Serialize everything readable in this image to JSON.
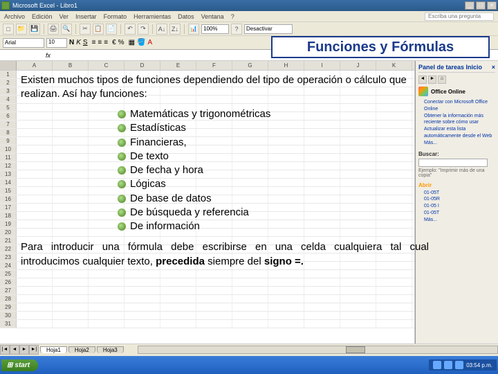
{
  "window": {
    "title": "Microsoft Excel - Libro1"
  },
  "menus": [
    "Archivo",
    "Edición",
    "Ver",
    "Insertar",
    "Formato",
    "Herramientas",
    "Datos",
    "Ventana",
    "?"
  ],
  "help_placeholder": "Escriba una pregunta",
  "toolbar": {
    "zoom": "100%",
    "dropdown": "Desactivar"
  },
  "format": {
    "font_name": "Arial",
    "font_size": "10"
  },
  "ref": {
    "cell_ref": "",
    "fx": "fx"
  },
  "columns": [
    "A",
    "B",
    "C",
    "D",
    "E",
    "F",
    "G",
    "H",
    "I",
    "J",
    "K"
  ],
  "rows": [
    "1",
    "2",
    "3",
    "4",
    "5",
    "6",
    "7",
    "8",
    "9",
    "10",
    "11",
    "12",
    "13",
    "14",
    "15",
    "16",
    "17",
    "18",
    "19",
    "20",
    "21",
    "22",
    "23",
    "24",
    "25",
    "26",
    "27",
    "28",
    "29",
    "30",
    "31"
  ],
  "overlay": {
    "title": "Funciones y Fórmulas",
    "intro": "Existen muchos tipos de funciones dependiendo del tipo de operación o cálculo que realizan. Así hay funciones:",
    "bullets": [
      "Matemáticas y trigonométricas",
      "Estadísticas",
      "Financieras,",
      "De texto",
      "De fecha y hora",
      "Lógicas",
      "De base de datos",
      "De búsqueda y referencia",
      "De información"
    ],
    "outro_pre": "Para introducir una fórmula debe escribirse en una celda cualquiera tal cual introducimos cualquier texto, ",
    "outro_bold": "precedida",
    "outro_mid": " siempre del ",
    "outro_bold2": "signo =."
  },
  "taskpane": {
    "title": "Panel de tareas Inicio",
    "office_label": "Office Online",
    "links": [
      "Conectar con Microsoft Office Online",
      "Obtener la información más reciente sobre cómo usar",
      "Actualizar esta lista automáticamente desde el Web",
      "Más..."
    ],
    "search_label": "Buscar:",
    "example": "Ejemplo: \"Imprimir más de una copia\"",
    "abrir": "Abrir",
    "files": [
      "01-05T",
      "01-05R",
      "01-05 I",
      "01-05T",
      "Más..."
    ]
  },
  "sheet_tabs": [
    "Hoja1",
    "Hoja2",
    "Hoja3"
  ],
  "taskbar": {
    "start": "start",
    "time": "03:54 p.m."
  }
}
